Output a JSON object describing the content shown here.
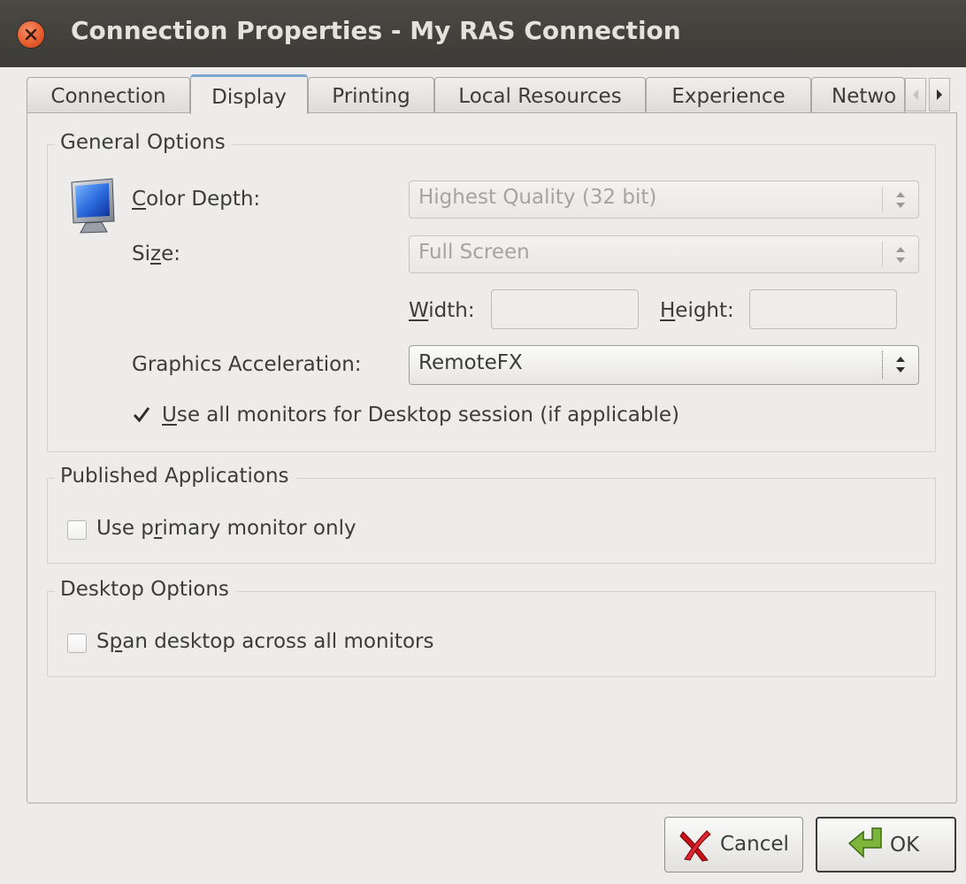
{
  "window": {
    "title": "Connection Properties - My RAS Connection"
  },
  "tabs": [
    {
      "label": "Connection",
      "active": false
    },
    {
      "label": "Display",
      "active": true
    },
    {
      "label": "Printing",
      "active": false
    },
    {
      "label": "Local Resources",
      "active": false
    },
    {
      "label": "Experience",
      "active": false
    },
    {
      "label": "Netwo",
      "active": false
    }
  ],
  "general_options": {
    "legend": "General Options",
    "color_depth": {
      "label_pre": "",
      "label_mnemonic": "C",
      "label_post": "olor Depth:",
      "value": "Highest Quality (32 bit)",
      "enabled": false
    },
    "size": {
      "label_pre": "Si",
      "label_mnemonic": "z",
      "label_post": "e:",
      "value": "Full Screen",
      "enabled": false
    },
    "width": {
      "label_pre": "",
      "label_mnemonic": "W",
      "label_post": "idth:",
      "value": ""
    },
    "height": {
      "label_pre": "",
      "label_mnemonic": "H",
      "label_post": "eight:",
      "value": ""
    },
    "graphics_acceleration": {
      "label": "Graphics Acceleration:",
      "value": "RemoteFX",
      "enabled": true
    },
    "use_all_monitors": {
      "label_pre": "",
      "label_mnemonic": "U",
      "label_post": "se all monitors for Desktop session (if applicable)",
      "checked": true
    }
  },
  "published_applications": {
    "legend": "Published Applications",
    "use_primary_monitor": {
      "label_pre": "Use p",
      "label_mnemonic": "r",
      "label_post": "imary monitor only",
      "checked": false
    }
  },
  "desktop_options": {
    "legend": "Desktop Options",
    "span_desktop": {
      "label_pre": "S",
      "label_mnemonic": "p",
      "label_post": "an desktop across all monitors",
      "checked": false
    }
  },
  "buttons": {
    "cancel": "Cancel",
    "ok": "OK"
  },
  "icons": {
    "close": "close-icon",
    "monitor": "monitor-icon",
    "cancel": "red-x-icon",
    "ok": "green-arrow-icon",
    "tab_left": "arrow-left-icon",
    "tab_right": "arrow-right-icon"
  },
  "colors": {
    "close_button": "#e45a2b",
    "title_bar": "#3c3b37",
    "window_bg": "#edeceb",
    "active_tab_accent": "#7fa6cf"
  }
}
